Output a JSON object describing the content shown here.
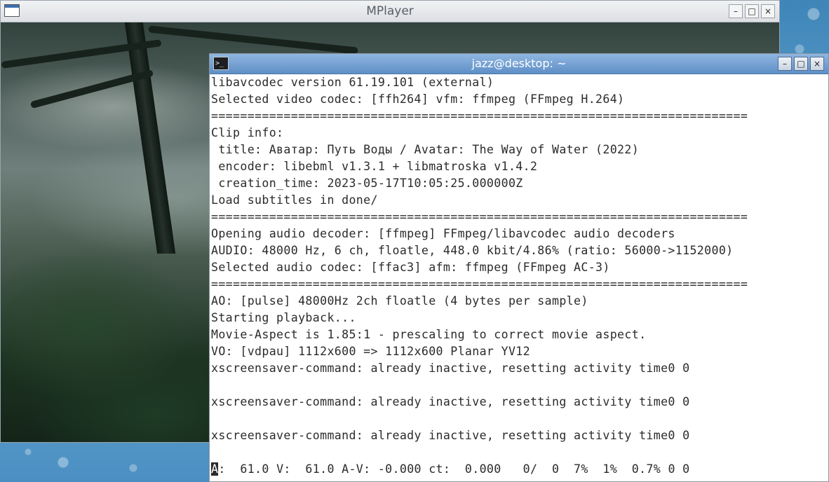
{
  "mplayer_window": {
    "title": "MPlayer",
    "buttons": {
      "minimize": "–",
      "maximize": "□",
      "close": "×"
    },
    "icon": "window-icon"
  },
  "terminal_window": {
    "title": "jazz@desktop: ~",
    "icon": "terminal-icon",
    "icon_glyph": ">_",
    "buttons": {
      "minimize": "–",
      "maximize": "□",
      "close": "×"
    },
    "lines": [
      "libavcodec version 61.19.101 (external)",
      "Selected video codec: [ffh264] vfm: ffmpeg (FFmpeg H.264)",
      "==========================================================================",
      "Clip info:",
      " title: Аватар: Путь Воды / Avatar: The Way of Water (2022)",
      " encoder: libebml v1.3.1 + libmatroska v1.4.2",
      " creation_time: 2023-05-17T10:05:25.000000Z",
      "Load subtitles in done/",
      "==========================================================================",
      "Opening audio decoder: [ffmpeg] FFmpeg/libavcodec audio decoders",
      "AUDIO: 48000 Hz, 6 ch, floatle, 448.0 kbit/4.86% (ratio: 56000->1152000)",
      "Selected audio codec: [ffac3] afm: ffmpeg (FFmpeg AC-3)",
      "==========================================================================",
      "AO: [pulse] 48000Hz 2ch floatle (4 bytes per sample)",
      "Starting playback...",
      "Movie-Aspect is 1.85:1 - prescaling to correct movie aspect.",
      "VO: [vdpau] 1112x600 => 1112x600 Planar YV12",
      "xscreensaver-command: already inactive, resetting activity time0 0",
      "",
      "xscreensaver-command: already inactive, resetting activity time0 0",
      "",
      "xscreensaver-command: already inactive, resetting activity time0 0",
      ""
    ],
    "status_cursor": "A",
    "status_rest": ":  61.0 V:  61.0 A-V: -0.000 ct:  0.000   0/  0  7%  1%  0.7% 0 0"
  }
}
